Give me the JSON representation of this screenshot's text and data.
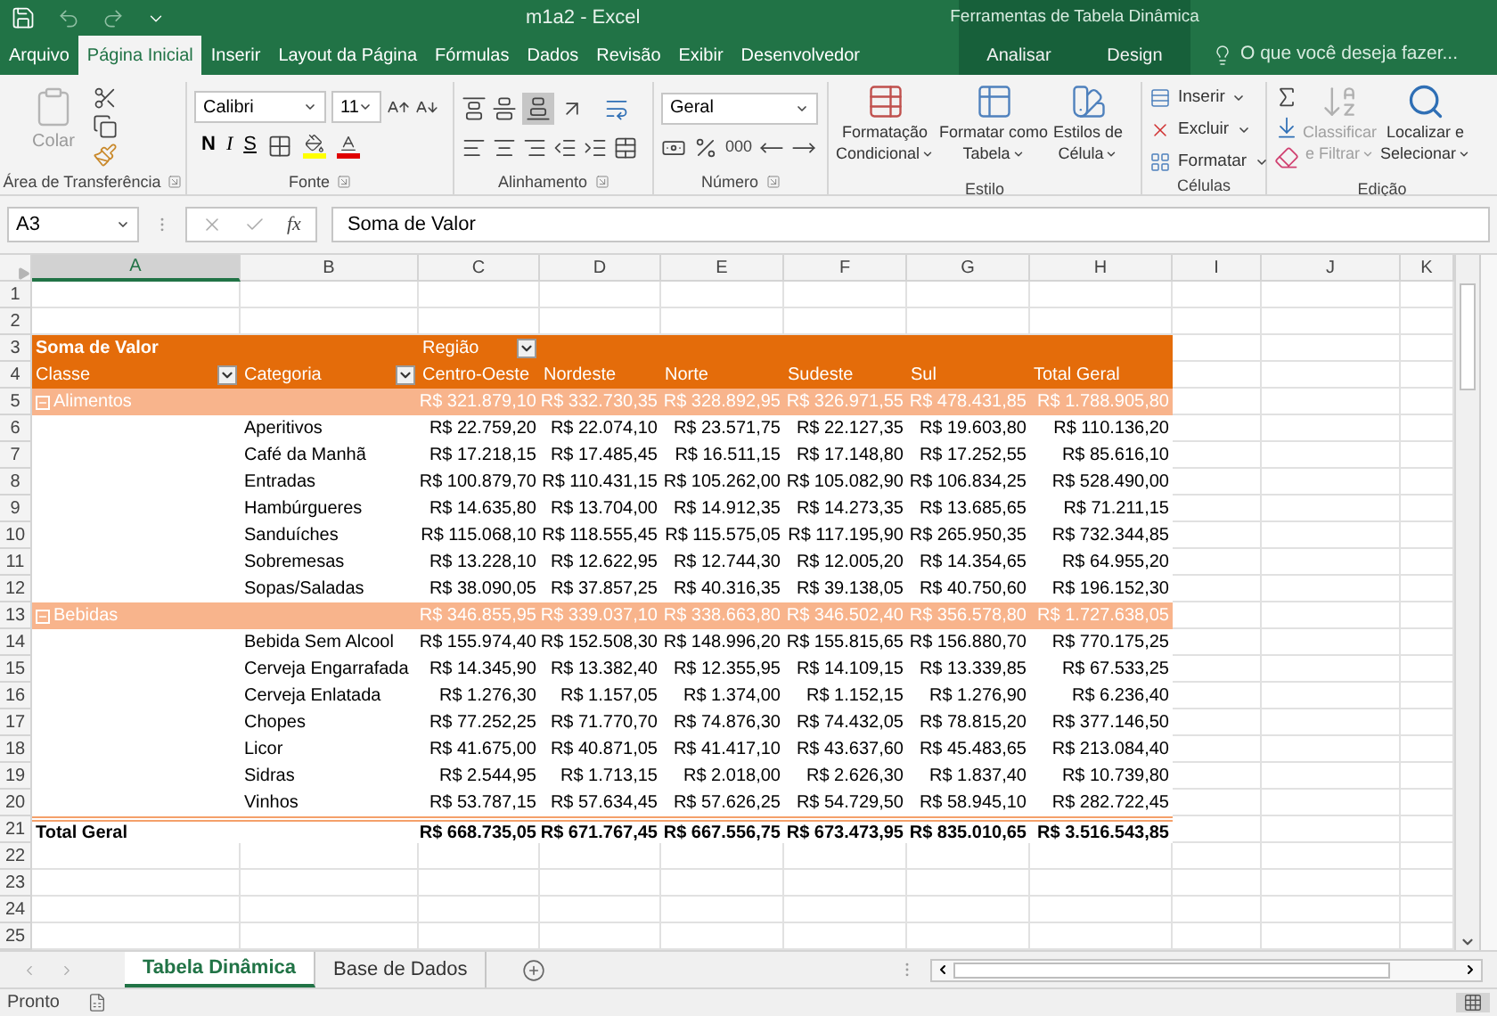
{
  "title_bar": {
    "title": "m1a2 - Excel",
    "context_title": "Ferramentas de Tabela Dinâmica"
  },
  "ribbon_tabs": [
    {
      "label": "Arquivo",
      "selected": false,
      "contextual": false
    },
    {
      "label": "Página Inicial",
      "selected": true,
      "contextual": false
    },
    {
      "label": "Inserir",
      "selected": false,
      "contextual": false
    },
    {
      "label": "Layout da Página",
      "selected": false,
      "contextual": false
    },
    {
      "label": "Fórmulas",
      "selected": false,
      "contextual": false
    },
    {
      "label": "Dados",
      "selected": false,
      "contextual": false
    },
    {
      "label": "Revisão",
      "selected": false,
      "contextual": false
    },
    {
      "label": "Exibir",
      "selected": false,
      "contextual": false
    },
    {
      "label": "Desenvolvedor",
      "selected": false,
      "contextual": false
    },
    {
      "label": "Analisar",
      "selected": false,
      "contextual": true
    },
    {
      "label": "Design",
      "selected": false,
      "contextual": true
    }
  ],
  "tell_me": {
    "placeholder": "O que você deseja fazer..."
  },
  "ribbon": {
    "clipboard": {
      "label": "Área de Transferência",
      "paste": {
        "label": "Colar",
        "disabled": true
      }
    },
    "font": {
      "label": "Fonte",
      "font_name": "Calibri",
      "font_size": "11",
      "bold": "N",
      "italic": "I",
      "underline": "S"
    },
    "alignment": {
      "label": "Alinhamento",
      "bottom_align_on": true
    },
    "number": {
      "label": "Número",
      "format": "Geral",
      "thousands": "000"
    },
    "styles": {
      "label": "Estilo",
      "buttons": [
        {
          "lines": [
            "Formatação",
            "Condicional"
          ]
        },
        {
          "lines": [
            "Formatar como",
            "Tabela"
          ]
        },
        {
          "lines": [
            "Estilos de",
            "Célula"
          ]
        }
      ]
    },
    "cells": {
      "label": "Células",
      "buttons": [
        "Inserir",
        "Excluir",
        "Formatar"
      ]
    },
    "editing": {
      "label": "Edição",
      "buttons": [
        {
          "lines": [
            "Classificar",
            "e Filtrar"
          ],
          "disabled": true
        },
        {
          "lines": [
            "Localizar e",
            "Selecionar"
          ],
          "disabled": false
        }
      ]
    }
  },
  "formula_bar": {
    "name_box": "A3",
    "function_label": "fx",
    "formula": "Soma de Valor"
  },
  "columns": [
    {
      "label": "A",
      "selected": true
    },
    {
      "label": "B",
      "selected": false
    },
    {
      "label": "C",
      "selected": false
    },
    {
      "label": "D",
      "selected": false
    },
    {
      "label": "E",
      "selected": false
    },
    {
      "label": "F",
      "selected": false
    },
    {
      "label": "G",
      "selected": false
    },
    {
      "label": "H",
      "selected": false
    },
    {
      "label": "I",
      "selected": false
    },
    {
      "label": "J",
      "selected": false
    },
    {
      "label": "K",
      "selected": false
    }
  ],
  "rows": [
    {
      "number": "1",
      "kind": "blank"
    },
    {
      "number": "2",
      "kind": "blank"
    },
    {
      "number": "3",
      "kind": "value_header",
      "value_label": "Soma de Valor",
      "column_field": "Região"
    },
    {
      "number": "4",
      "kind": "column_header",
      "row_fields": [
        "Classe",
        "Categoria"
      ],
      "headers": [
        "Centro-Oeste",
        "Nordeste",
        "Norte",
        "Sudeste",
        "Sul",
        "Total Geral"
      ]
    },
    {
      "number": "5",
      "kind": "group",
      "label": "Alimentos",
      "expanded": true,
      "values": [
        "R$ 321.879,10",
        "R$ 332.730,35",
        "R$ 328.892,95",
        "R$ 326.971,55",
        "R$ 478.431,85",
        "R$ 1.788.905,80"
      ]
    },
    {
      "number": "6",
      "kind": "item",
      "label": "Aperitivos",
      "values": [
        "R$ 22.759,20",
        "R$ 22.074,10",
        "R$ 23.571,75",
        "R$ 22.127,35",
        "R$ 19.603,80",
        "R$ 110.136,20"
      ]
    },
    {
      "number": "7",
      "kind": "item",
      "label": "Café da Manhã",
      "values": [
        "R$ 17.218,15",
        "R$ 17.485,45",
        "R$ 16.511,15",
        "R$ 17.148,80",
        "R$ 17.252,55",
        "R$ 85.616,10"
      ]
    },
    {
      "number": "8",
      "kind": "item",
      "label": "Entradas",
      "values": [
        "R$ 100.879,70",
        "R$ 110.431,15",
        "R$ 105.262,00",
        "R$ 105.082,90",
        "R$ 106.834,25",
        "R$ 528.490,00"
      ]
    },
    {
      "number": "9",
      "kind": "item",
      "label": "Hambúrgueres",
      "values": [
        "R$ 14.635,80",
        "R$ 13.704,00",
        "R$ 14.912,35",
        "R$ 14.273,35",
        "R$ 13.685,65",
        "R$ 71.211,15"
      ]
    },
    {
      "number": "10",
      "kind": "item",
      "label": "Sanduíches",
      "values": [
        "R$ 115.068,10",
        "R$ 118.555,45",
        "R$ 115.575,05",
        "R$ 117.195,90",
        "R$ 265.950,35",
        "R$ 732.344,85"
      ]
    },
    {
      "number": "11",
      "kind": "item",
      "label": "Sobremesas",
      "values": [
        "R$ 13.228,10",
        "R$ 12.622,95",
        "R$ 12.744,30",
        "R$ 12.005,20",
        "R$ 14.354,65",
        "R$ 64.955,20"
      ]
    },
    {
      "number": "12",
      "kind": "item",
      "label": "Sopas/Saladas",
      "values": [
        "R$ 38.090,05",
        "R$ 37.857,25",
        "R$ 40.316,35",
        "R$ 39.138,05",
        "R$ 40.750,60",
        "R$ 196.152,30"
      ]
    },
    {
      "number": "13",
      "kind": "group",
      "label": "Bebidas",
      "expanded": true,
      "values": [
        "R$ 346.855,95",
        "R$ 339.037,10",
        "R$ 338.663,80",
        "R$ 346.502,40",
        "R$ 356.578,80",
        "R$ 1.727.638,05"
      ]
    },
    {
      "number": "14",
      "kind": "item",
      "label": "Bebida Sem Alcool",
      "values": [
        "R$ 155.974,40",
        "R$ 152.508,30",
        "R$ 148.996,20",
        "R$ 155.815,65",
        "R$ 156.880,70",
        "R$ 770.175,25"
      ]
    },
    {
      "number": "15",
      "kind": "item",
      "label": "Cerveja Engarrafada",
      "values": [
        "R$ 14.345,90",
        "R$ 13.382,40",
        "R$ 12.355,95",
        "R$ 14.109,15",
        "R$ 13.339,85",
        "R$ 67.533,25"
      ]
    },
    {
      "number": "16",
      "kind": "item",
      "label": "Cerveja Enlatada",
      "values": [
        "R$ 1.276,30",
        "R$ 1.157,05",
        "R$ 1.374,00",
        "R$ 1.152,15",
        "R$ 1.276,90",
        "R$ 6.236,40"
      ]
    },
    {
      "number": "17",
      "kind": "item",
      "label": "Chopes",
      "values": [
        "R$ 77.252,25",
        "R$ 71.770,70",
        "R$ 74.876,30",
        "R$ 74.432,05",
        "R$ 78.815,20",
        "R$ 377.146,50"
      ]
    },
    {
      "number": "18",
      "kind": "item",
      "label": "Licor",
      "values": [
        "R$ 41.675,00",
        "R$ 40.871,05",
        "R$ 41.417,10",
        "R$ 43.637,60",
        "R$ 45.483,65",
        "R$ 213.084,40"
      ]
    },
    {
      "number": "19",
      "kind": "item",
      "label": "Sidras",
      "values": [
        "R$ 2.544,95",
        "R$ 1.713,15",
        "R$ 2.018,00",
        "R$ 2.626,30",
        "R$ 1.837,40",
        "R$ 10.739,80"
      ]
    },
    {
      "number": "20",
      "kind": "item",
      "label": "Vinhos",
      "values": [
        "R$ 53.787,15",
        "R$ 57.634,45",
        "R$ 57.626,25",
        "R$ 54.729,50",
        "R$ 58.945,10",
        "R$ 282.722,45"
      ]
    },
    {
      "number": "21",
      "kind": "total",
      "label": "Total Geral",
      "values": [
        "R$ 668.735,05",
        "R$ 671.767,45",
        "R$ 667.556,75",
        "R$ 673.473,95",
        "R$ 835.010,65",
        "R$ 3.516.543,85"
      ]
    },
    {
      "number": "22",
      "kind": "blank"
    },
    {
      "number": "23",
      "kind": "blank"
    },
    {
      "number": "24",
      "kind": "blank"
    },
    {
      "number": "25",
      "kind": "blank"
    }
  ],
  "sheet_tabs": [
    {
      "label": "Tabela Dinâmica",
      "selected": true
    },
    {
      "label": "Base de Dados",
      "selected": false
    }
  ],
  "status_bar": {
    "status": "Pronto"
  }
}
